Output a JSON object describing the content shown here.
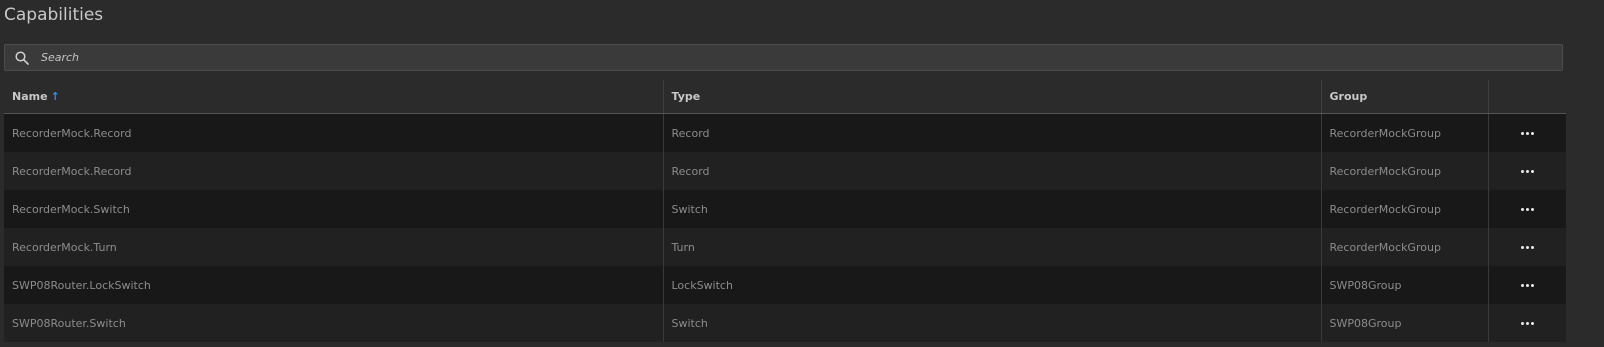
{
  "header": {
    "title": "Capabilities"
  },
  "search": {
    "placeholder": "Search",
    "value": ""
  },
  "table": {
    "columns": [
      {
        "label": "Name",
        "sort": "ascending"
      },
      {
        "label": "Type"
      },
      {
        "label": "Group"
      },
      {
        "label": ""
      }
    ],
    "sort_arrow": "↑",
    "rows": [
      {
        "name": "RecorderMock.Record",
        "type": "Record",
        "group": "RecorderMockGroup"
      },
      {
        "name": "RecorderMock.Record",
        "type": "Record",
        "group": "RecorderMockGroup"
      },
      {
        "name": "RecorderMock.Switch",
        "type": "Switch",
        "group": "RecorderMockGroup"
      },
      {
        "name": "RecorderMock.Turn",
        "type": "Turn",
        "group": "RecorderMockGroup"
      },
      {
        "name": "SWP08Router.LockSwitch",
        "type": "LockSwitch",
        "group": "SWP08Group"
      },
      {
        "name": "SWP08Router.Switch",
        "type": "Switch",
        "group": "SWP08Group"
      }
    ]
  },
  "colors": {
    "background": "#2b2b2b",
    "sort_accent": "#2d8cf0",
    "row_odd": "#181818",
    "row_even": "#212121"
  },
  "icons": {
    "search": "search-icon",
    "row_menu": "more-horizontal-icon"
  }
}
